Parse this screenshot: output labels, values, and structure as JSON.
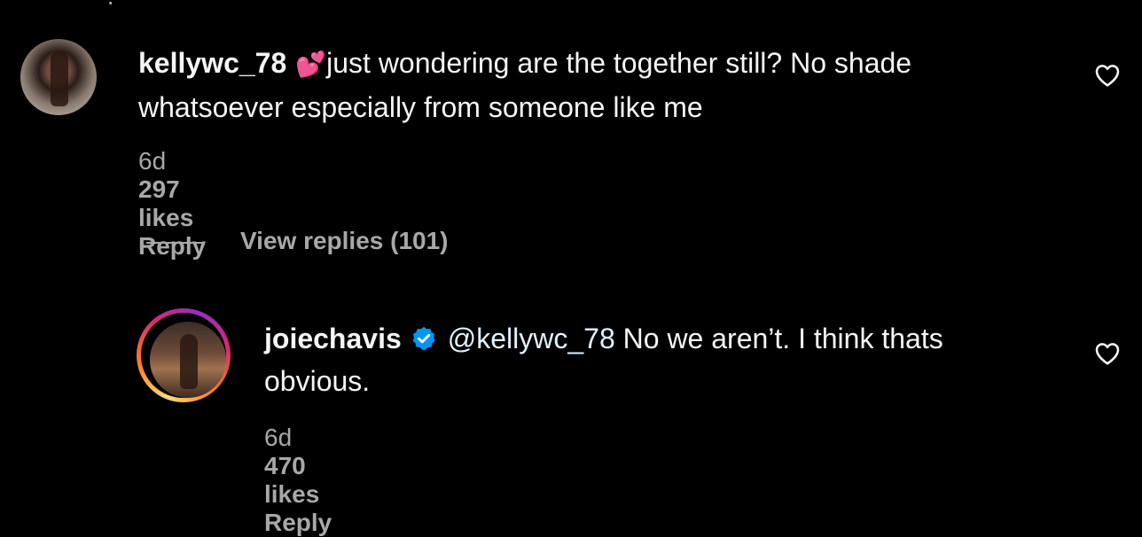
{
  "top_partial": "· ʺ",
  "comments": [
    {
      "username": "kellywc_78",
      "emoji": "💕",
      "text": "just wondering are the together still? No shade whatsoever especially from someone like me",
      "age": "6d",
      "likes": "297 likes",
      "reply_label": "Reply"
    },
    {
      "username": "joiechavis",
      "mention": "@kellywc_78",
      "text": " No we aren’t. I think thats obvious.",
      "age": "6d",
      "likes": "470 likes",
      "reply_label": "Reply"
    }
  ],
  "view_replies": "View replies (101)",
  "colors": {
    "background": "#000000",
    "text": "#f5f5f5",
    "secondary": "#a8a8a8",
    "verified": "#0095f6",
    "story_ring": [
      "#feda75",
      "#fa7e1e",
      "#d62976",
      "#962fbf"
    ]
  },
  "icons": {
    "like": "heart-outline-icon",
    "verified": "verified-badge-icon"
  }
}
